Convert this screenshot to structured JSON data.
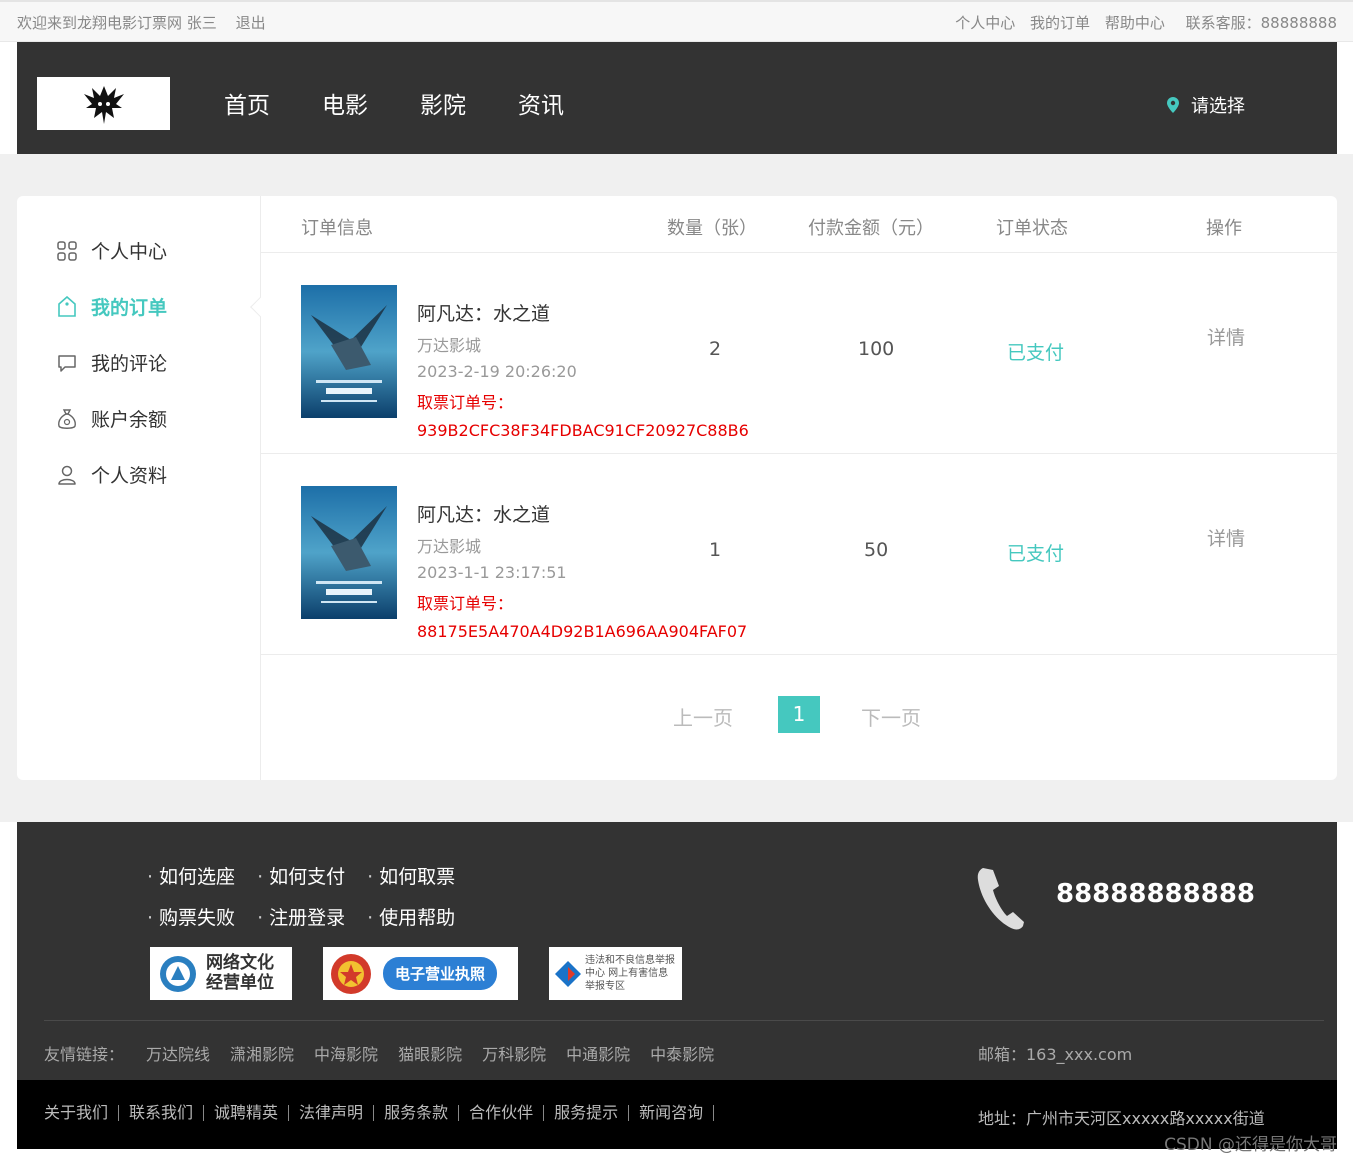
{
  "topbar": {
    "welcome": "欢迎来到龙翔电影订票网 张三",
    "logout": "退出",
    "links": [
      "个人中心",
      "我的订单",
      "帮助中心"
    ],
    "service": "联系客服：88888888"
  },
  "header": {
    "nav": [
      "首页",
      "电影",
      "影院",
      "资讯"
    ],
    "city": "请选择"
  },
  "sidebar": {
    "items": [
      {
        "label": "个人中心",
        "icon": "grid-icon"
      },
      {
        "label": "我的订单",
        "icon": "tag-icon"
      },
      {
        "label": "我的评论",
        "icon": "comment-icon"
      },
      {
        "label": "账户余额",
        "icon": "moneybag-icon"
      },
      {
        "label": "个人资料",
        "icon": "user-icon"
      }
    ],
    "active": "我的订单"
  },
  "table": {
    "headers": [
      "订单信息",
      "数量（张）",
      "付款金额（元）",
      "订单状态",
      "操作"
    ],
    "orders": [
      {
        "title": "阿凡达：水之道",
        "cinema": "万达影城",
        "time": "2023-2-19 20:26:20",
        "code_label": "取票订单号：",
        "code": "939B2CFC38F34FDBAC91CF20927C88B6",
        "qty": "2",
        "amount": "100",
        "status": "已支付",
        "action": "详情"
      },
      {
        "title": "阿凡达：水之道",
        "cinema": "万达影城",
        "time": "2023-1-1 23:17:51",
        "code_label": "取票订单号：",
        "code": "88175E5A470A4D92B1A696AA904FAF07",
        "qty": "1",
        "amount": "50",
        "status": "已支付",
        "action": "详情"
      }
    ]
  },
  "pager": {
    "prev": "上一页",
    "current": "1",
    "next": "下一页"
  },
  "footer": {
    "help": [
      [
        "如何选座",
        "如何支付",
        "如何取票"
      ],
      [
        "购票失败",
        "注册登录",
        "使用帮助"
      ]
    ],
    "badges": [
      "网络文化经营单位",
      "电子营业执照",
      "违法和不良信息举报中心 网上有害信息举报专区"
    ],
    "phone": "88888888888",
    "links_label": "友情链接：",
    "links": [
      "万达院线",
      "潇湘影院",
      "中海影院",
      "猫眼影院",
      "万科影院",
      "中通影院",
      "中泰影院"
    ],
    "email": "邮箱：163_xxx.com",
    "bottom_links": [
      "关于我们",
      "联系我们",
      "诚聘精英",
      "法律声明",
      "服务条款",
      "合作伙伴",
      "服务提示",
      "新闻咨询"
    ],
    "address": "地址：广州市天河区xxxxx路xxxxx街道"
  },
  "watermark": "CSDN @还得是你大哥",
  "colors": {
    "accent": "#45c8bf",
    "code": "#e60000",
    "header_bg": "#333333"
  }
}
